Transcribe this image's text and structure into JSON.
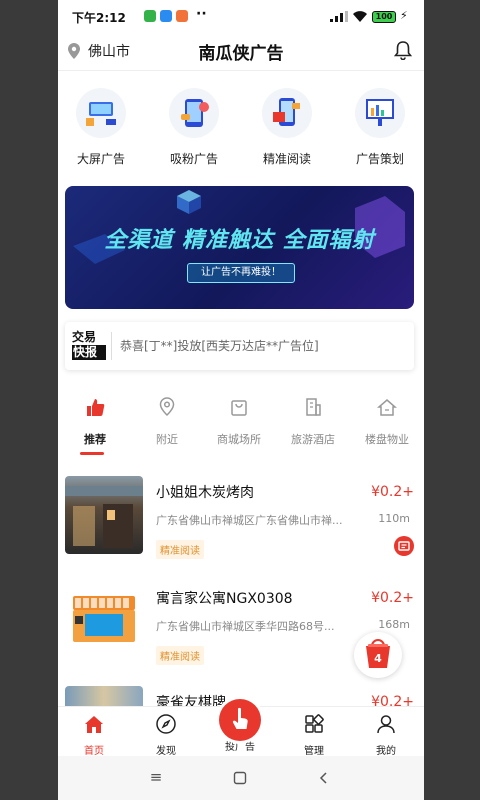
{
  "status_bar": {
    "time": "下午2:12",
    "battery": "100"
  },
  "header": {
    "location": "佛山市",
    "title": "南瓜侠广告"
  },
  "quick_menu": [
    {
      "label": "大屏广告",
      "icon": "big-screen-icon"
    },
    {
      "label": "吸粉广告",
      "icon": "fans-icon"
    },
    {
      "label": "精准阅读",
      "icon": "reading-icon"
    },
    {
      "label": "广告策划",
      "icon": "planning-icon"
    }
  ],
  "banner": {
    "headline": "全渠道 精准触达 全面辐射",
    "sub": "让广告不再难投！",
    "active_slide": 2,
    "slides": 4
  },
  "news": {
    "logo_top": "交易",
    "logo_bottom": "快报",
    "text": "恭喜[丁**]投放[西芙万达店**广告位]"
  },
  "categories": [
    {
      "label": "推荐",
      "icon": "thumbs-up-icon",
      "active": true
    },
    {
      "label": "附近",
      "icon": "location-pin-icon",
      "active": false
    },
    {
      "label": "商城场所",
      "icon": "shopping-bag-icon",
      "active": false
    },
    {
      "label": "旅游酒店",
      "icon": "building-icon",
      "active": false
    },
    {
      "label": "楼盘物业",
      "icon": "house-icon",
      "active": false
    }
  ],
  "listings": [
    {
      "name": "小姐姐木炭烤肉",
      "price": "¥0.2+",
      "address": "广东省佛山市禅城区广东省佛山市禅...",
      "distance": "110m",
      "tag": "精准阅读"
    },
    {
      "name": "寓言家公寓NGX0308",
      "price": "¥0.2+",
      "address": "广东省佛山市禅城区季华四路68号...",
      "distance": "168m",
      "tag": "精准阅读"
    },
    {
      "name": "豪雀友棋牌",
      "price": "¥0.2+",
      "address": "",
      "distance": "",
      "tag": ""
    }
  ],
  "cart": {
    "count": "4"
  },
  "tabbar": [
    {
      "label": "首页",
      "active": true
    },
    {
      "label": "发现",
      "active": false
    },
    {
      "label": "投广告",
      "active": false
    },
    {
      "label": "管理",
      "active": false
    },
    {
      "label": "我的",
      "active": false
    }
  ],
  "colors": {
    "accent": "#e8372c",
    "tag_text": "#e0922e",
    "banner_text": "#5fe6f0"
  }
}
